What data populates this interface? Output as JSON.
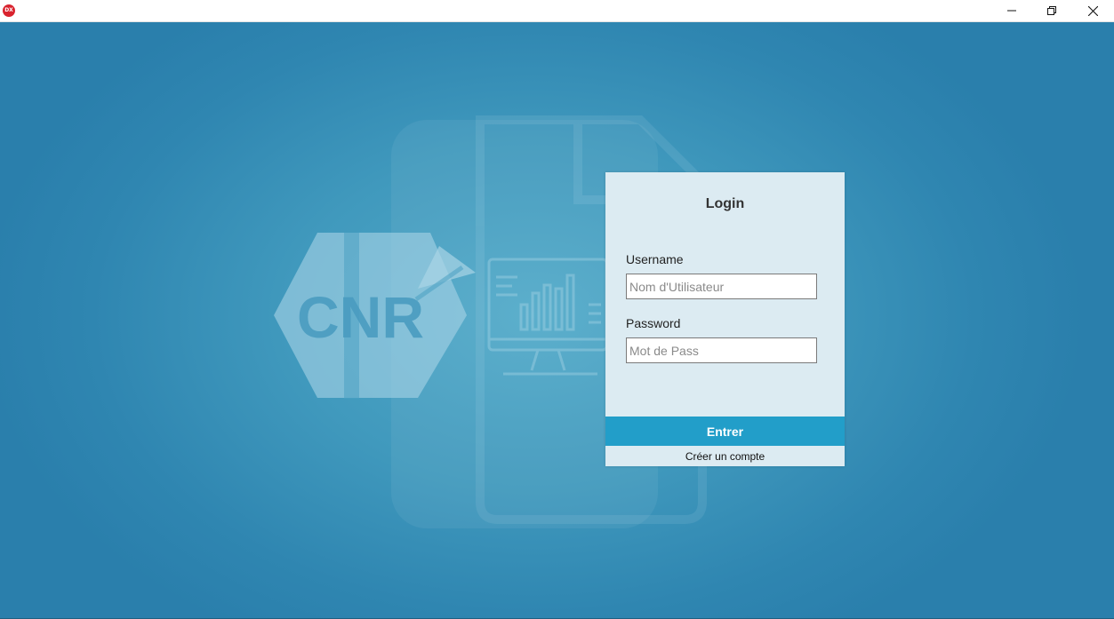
{
  "window": {
    "app_icon_text": "DX",
    "controls": {
      "minimize_icon": "minimize-icon",
      "restore_icon": "restore-icon",
      "close_icon": "close-icon"
    }
  },
  "logo": {
    "text": "CNR"
  },
  "login": {
    "title": "Login",
    "username_label": "Username",
    "username_placeholder": "Nom d'Utilisateur",
    "username_value": "",
    "password_label": "Password",
    "password_placeholder": "Mot de Pass",
    "password_value": "",
    "submit_label": "Entrer",
    "create_account_label": "Créer un compte"
  },
  "colors": {
    "background_center": "#52aac9",
    "background_edge": "#2a7fac",
    "panel_background": "#dcebf2",
    "accent_button": "#229ec9"
  }
}
